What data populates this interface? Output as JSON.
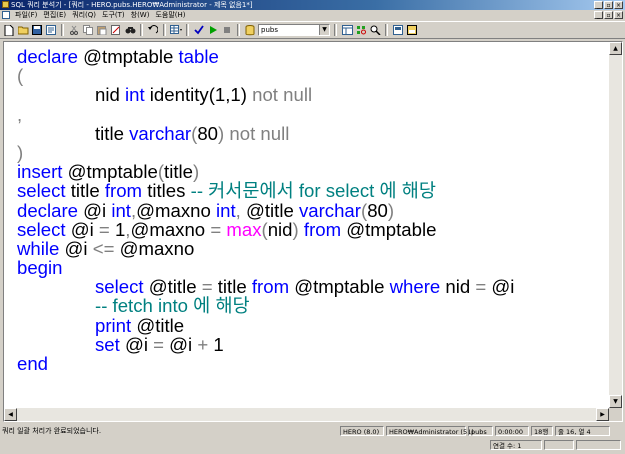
{
  "window": {
    "title": "SQL 쿼리 분석기 - [쿼리 - HERO.pubs.HERO₩Administrator - 제목 없음1*]",
    "controls": [
      "_",
      "▫",
      "×"
    ]
  },
  "menu": {
    "items": [
      "파일(F)",
      "편집(E)",
      "쿼리(Q)",
      "도구(T)",
      "창(W)",
      "도움말(H)"
    ],
    "mdi_controls": [
      "_",
      "▫",
      "×"
    ]
  },
  "toolbar": {
    "database": "pubs",
    "icons": [
      "new-query-icon",
      "open-icon",
      "save-icon",
      "load-script-icon",
      "cut-icon",
      "copy-icon",
      "paste-icon",
      "clear-icon",
      "find-icon",
      "undo-icon",
      "results-mode-icon",
      "parse-icon",
      "execute-icon",
      "stop-icon",
      "database-icon",
      "object-browser-icon",
      "object-search-icon",
      "show-estimated-plan-icon",
      "options-icon",
      "results-pane-icon"
    ]
  },
  "editor": {
    "lines": [
      "declare @tmptable table",
      "(",
      "nid int identity(1,1) not null",
      ",",
      "title varchar(80) not null",
      ")",
      "insert @tmptable(title)",
      "select title from titles -- 커서문에서 for select 에 해당",
      "declare @i int,@maxno int, @title varchar(80)",
      "select @i = 1,@maxno = max(nid) from @tmptable",
      "while @i <= @maxno",
      "begin",
      "select @title = title from @tmptable where nid = @i",
      "-- fetch into 에 해당",
      "print @title",
      "set @i = @i + 1",
      "end"
    ],
    "tokens": {
      "declare": "declare",
      "table": "table",
      "int": "int",
      "identity": "identity(1,1)",
      "not_null": "not null",
      "varchar": "varchar",
      "insert": "insert",
      "select": "select",
      "from": "from",
      "comment1": "-- 커서문에서 for select 에 해당",
      "max": "max",
      "while": "while",
      "begin": "begin",
      "where": "where",
      "comment2": "-- fetch into 에 해당",
      "print": "print",
      "set": "set",
      "end": "end"
    },
    "syntax_colors": {
      "keyword": "#0000ff",
      "operator": "#808080",
      "function": "#ff00ff",
      "comment": "#008080",
      "text": "#000000"
    }
  },
  "status": {
    "message": "쿼리 일괄 처리가 완료되었습니다.",
    "server": "HERO (8.0)",
    "user": "HERO₩Administrator (51)",
    "database": "pubs",
    "elapsed": "0:00:00",
    "rows": "18행",
    "position": "줄 16, 열 4",
    "connections": "연결 수: 1"
  }
}
